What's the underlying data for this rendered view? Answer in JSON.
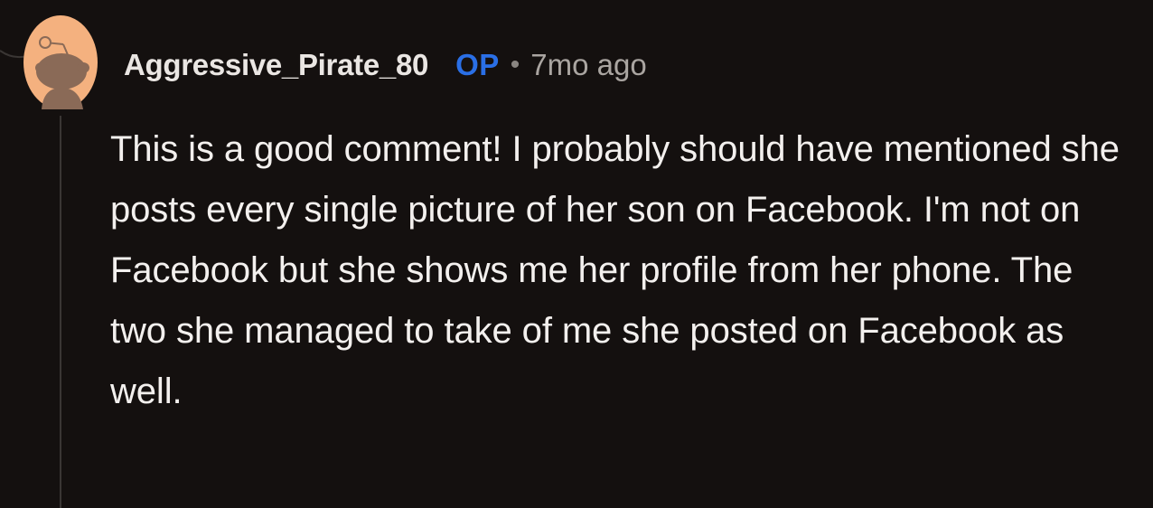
{
  "comment": {
    "author": "Aggressive_Pirate_80",
    "op_badge": "OP",
    "separator": "•",
    "timestamp": "7mo ago",
    "body": "This is a good comment! I probably should have mentioned she posts every single picture of her son on Facebook. I'm not on Facebook but she shows me her profile from her phone. The two she managed to take of me she posted on Facebook as well."
  },
  "avatar": {
    "icon": "snoo-avatar-icon",
    "background_color": "#f4b17f",
    "figure_color": "#8a6a57"
  },
  "colors": {
    "background": "#14100f",
    "op_badge": "#2a6fe6",
    "text": "#f3f0ee",
    "muted": "#aaa5a1",
    "thread_line": "#3a3634"
  }
}
